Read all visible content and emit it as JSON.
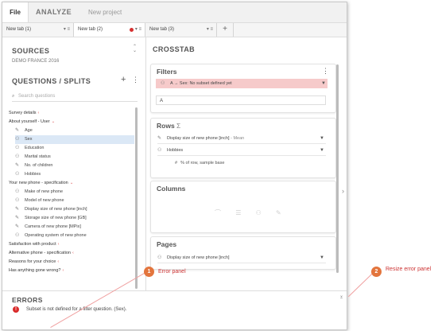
{
  "topbar": {
    "file": "File",
    "analyze": "ANALYZE",
    "new_project": "New project"
  },
  "tabs": [
    {
      "label": "New tab (1)",
      "ctl": "▾ ≡"
    },
    {
      "label": "New tab (2)",
      "ctl": "▾ ≡"
    },
    {
      "label": "New tab (3)",
      "ctl": "▾ ≡"
    }
  ],
  "add_tab": "+",
  "sources": {
    "title": "SOURCES",
    "dataset": "DEMO FRANCE 2016"
  },
  "questions": {
    "title": "QUESTIONS / SPLITS",
    "search_placeholder": "Search questions",
    "add": "+",
    "more": "⋮"
  },
  "tree": [
    {
      "label": "Survey details",
      "type": "group",
      "chev": "‹"
    },
    {
      "label": "About yourself - User",
      "type": "group",
      "chev": "⌄"
    },
    {
      "label": "Age",
      "type": "item",
      "icon": "pencil-icon"
    },
    {
      "label": "Sex",
      "type": "item",
      "icon": "group-icon",
      "selected": true
    },
    {
      "label": "Education",
      "type": "item",
      "icon": "group-icon"
    },
    {
      "label": "Marital status",
      "type": "item",
      "icon": "group-icon"
    },
    {
      "label": "No. of children",
      "type": "item",
      "icon": "pencil-icon"
    },
    {
      "label": "Hobbies",
      "type": "item",
      "icon": "multi-icon"
    },
    {
      "label": "Your new phone - specification",
      "type": "group",
      "chev": "⌄"
    },
    {
      "label": "Make of new phone",
      "type": "item",
      "icon": "group-icon"
    },
    {
      "label": "Model of new phone",
      "type": "item",
      "icon": "group-icon"
    },
    {
      "label": "Display size of new phone [inch]",
      "type": "item",
      "icon": "pencil-icon"
    },
    {
      "label": "Storage size of new phone [GB]",
      "type": "item",
      "icon": "pencil-icon"
    },
    {
      "label": "Camera of new phone [MPix]",
      "type": "item",
      "icon": "pencil-icon"
    },
    {
      "label": "Operating system of new phone",
      "type": "item",
      "icon": "group-icon"
    },
    {
      "label": "Satisfaction with product",
      "type": "group",
      "chev": "‹"
    },
    {
      "label": "Alternative phone - specification",
      "type": "group",
      "chev": "‹"
    },
    {
      "label": "Reasons for your choice",
      "type": "group",
      "chev": "‹"
    },
    {
      "label": "Has anything gone wrong?",
      "type": "group",
      "chev": "‹"
    }
  ],
  "crosstab": {
    "title": "CROSSTAB"
  },
  "filters": {
    "title": "Filters",
    "row": "A → Sex: No subset defined yet",
    "input_value": "A"
  },
  "rows": {
    "title": "Rows",
    "sigma": "Σ",
    "items": [
      {
        "label": "Display size of new phone [inch]",
        "suffix": "- Mean"
      },
      {
        "label": "Hobbies",
        "suffix": ""
      }
    ],
    "sub": "% of row, sample base"
  },
  "columns": {
    "title": "Columns"
  },
  "pages": {
    "title": "Pages",
    "item": "Display size of new phone [inch]"
  },
  "errors": {
    "title": "ERRORS",
    "message": "Subset is not defined for a filter question. (Sex)."
  },
  "callouts": [
    {
      "num": "1",
      "text": "Error panel"
    },
    {
      "num": "2",
      "text": "Resize error panel"
    }
  ],
  "colors": {
    "accent": "#e3753d",
    "error": "#d92b2b",
    "error_row_bg": "#f6caca",
    "selected_bg": "#dbe8f6"
  }
}
